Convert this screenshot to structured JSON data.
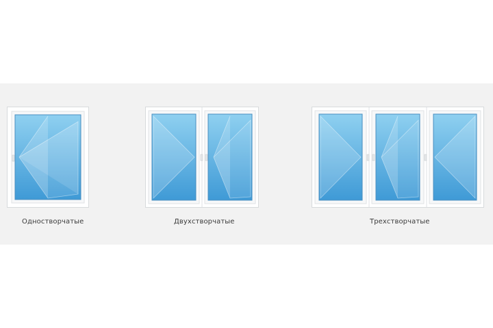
{
  "colors": {
    "background": "#f2f2f2",
    "frame": "#ffffff",
    "glass_light": "#8fd0f0",
    "glass_dark": "#3f9ad6"
  },
  "windows": [
    {
      "label": "Одностворчатые",
      "sashes": [
        "tilt-turn-left"
      ]
    },
    {
      "label": "Двухстворчатые",
      "sashes": [
        "turn-right",
        "tilt-turn-left"
      ]
    },
    {
      "label": "Трехстворчатые",
      "sashes": [
        "turn-right",
        "tilt-turn-left",
        "turn-left"
      ]
    }
  ]
}
